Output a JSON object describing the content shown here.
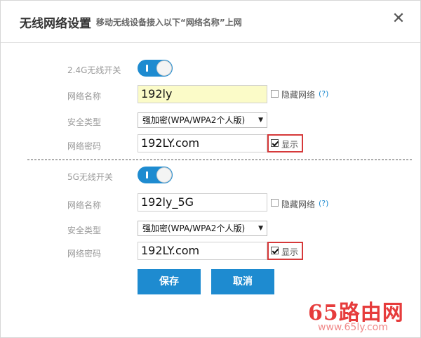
{
  "header": {
    "title": "无线网络设置",
    "subtitle": "移动无线设备接入以下“网络名称”上网",
    "close_icon": "close-icon"
  },
  "band24": {
    "switch_label": "2.4G无线开关",
    "switch_on": true,
    "ssid_label": "网络名称",
    "ssid_value": "192ly",
    "hide_label": "隐藏网络",
    "hide_checked": false,
    "help": "(?)",
    "security_label": "安全类型",
    "security_value": "强加密(WPA/WPA2个人版)",
    "password_label": "网络密码",
    "password_value": "192LY.com",
    "show_label": "显示",
    "show_checked": true
  },
  "band5": {
    "switch_label": "5G无线开关",
    "switch_on": true,
    "ssid_label": "网络名称",
    "ssid_value": "192ly_5G",
    "hide_label": "隐藏网络",
    "hide_checked": false,
    "help": "(?)",
    "security_label": "安全类型",
    "security_value": "强加密(WPA/WPA2个人版)",
    "password_label": "网络密码",
    "password_value": "192LY.com",
    "show_label": "显示",
    "show_checked": true
  },
  "buttons": {
    "save": "保存",
    "cancel": "取消"
  },
  "watermark": {
    "brand": "65路由网",
    "url": "www.65ly.com"
  },
  "colors": {
    "accent": "#1e8bd0",
    "highlight_box": "#d6393a",
    "autofill_bg": "#fbfbc8",
    "watermark": "#e63c3c"
  }
}
